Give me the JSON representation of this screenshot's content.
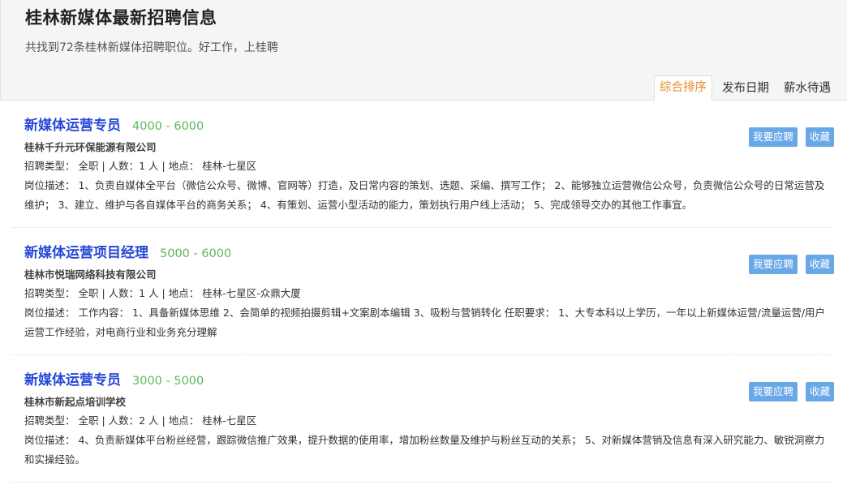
{
  "header": {
    "title": "桂林新媒体最新招聘信息",
    "subtitle": "共找到72条桂林新媒体招聘职位。好工作，上桂聘"
  },
  "sort_tabs": [
    {
      "label": "综合排序",
      "active": true
    },
    {
      "label": "发布日期",
      "active": false
    },
    {
      "label": "薪水待遇",
      "active": false
    }
  ],
  "colors": {
    "title_link": "#2647d6",
    "salary": "#5cb85c",
    "active_tab": "#e98a2c",
    "button": "#69a8e6"
  },
  "buttons": {
    "apply": "我要应聘",
    "favorite": "收藏"
  },
  "jobs": [
    {
      "title": "新媒体运营专员",
      "salary": "4000 - 6000",
      "company": "桂林千升元环保能源有限公司",
      "meta": "招聘类型： 全职 | 人数：1 人 | 地点： 桂林-七星区",
      "desc": "岗位描述： 1、负责自媒体全平台（微信公众号、微博、官网等）打造，及日常内容的策划、选题、采编、撰写工作； 2、能够独立运营微信公众号，负责微信公众号的日常运营及维护； 3、建立、维护与各自媒体平台的商务关系； 4、有策划、运营小型活动的能力，策划执行用户线上活动； 5、完成领导交办的其他工作事宜。"
    },
    {
      "title": "新媒体运营项目经理",
      "salary": "5000 - 6000",
      "company": "桂林市悦瑞网络科技有限公司",
      "meta": "招聘类型： 全职 | 人数：1 人 | 地点： 桂林-七星区-众鼎大厦",
      "desc": "岗位描述： 工作内容： 1、具备新媒体思维 2、会简单的视频拍摄剪辑+文案剧本编辑 3、吸粉与营销转化 任职要求： 1、大专本科以上学历，一年以上新媒体运营/流量运营/用户运营工作经验，对电商行业和业务充分理解"
    },
    {
      "title": "新媒体运营专员",
      "salary": "3000 - 5000",
      "company": "桂林市新起点培训学校",
      "meta": "招聘类型： 全职 | 人数：2 人 | 地点： 桂林-七星区",
      "desc": "岗位描述： 4、负责新媒体平台粉丝经营，跟踪微信推广效果，提升数据的使用率，增加粉丝数量及维护与粉丝互动的关系； 5、对新媒体营销及信息有深入研究能力、敏锐洞察力和实操经验。"
    }
  ]
}
